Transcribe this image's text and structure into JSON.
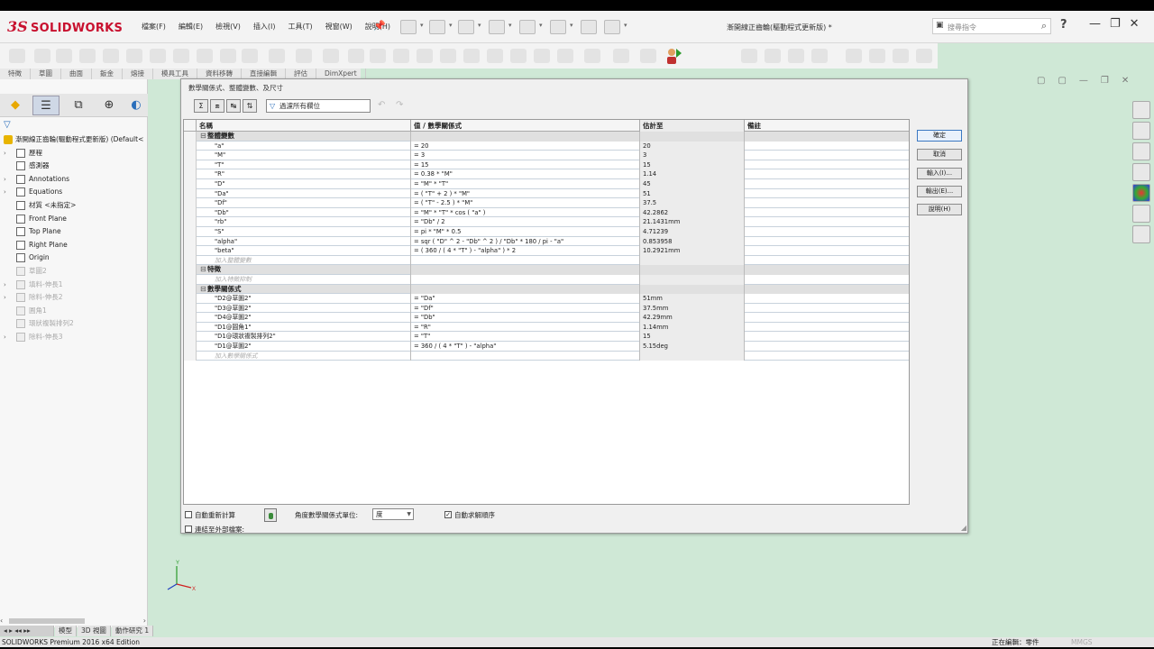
{
  "app": {
    "logo_mark": "3S",
    "logo_text": "SOLIDWORKS",
    "menu": [
      "檔案(F)",
      "編輯(E)",
      "檢視(V)",
      "插入(I)",
      "工具(T)",
      "視窗(W)",
      "說明(H)"
    ],
    "document_title": "漸開線正齒輪(驅動程式更新版) *",
    "search_placeholder": "搜尋指令",
    "help_symbol": "?",
    "window_buttons": [
      "—",
      "❐",
      "✕"
    ],
    "accent_color": "#c8102e"
  },
  "command_tabs": [
    "特徵",
    "草圖",
    "曲面",
    "鈑金",
    "熔接",
    "模具工具",
    "資料移轉",
    "直接編輯",
    "評估",
    "DimXpert"
  ],
  "feature_tree": {
    "root": "漸開線正齒輪(驅動程式更新版)  (Default<",
    "items": [
      {
        "label": "歷程",
        "expand": "›",
        "icon": "history-icon",
        "gray": false
      },
      {
        "label": "感測器",
        "expand": "",
        "icon": "sensor-icon",
        "gray": false
      },
      {
        "label": "Annotations",
        "expand": "›",
        "icon": "annotations-icon",
        "gray": false
      },
      {
        "label": "Equations",
        "expand": "›",
        "icon": "equations-icon",
        "gray": false
      },
      {
        "label": "材質 <未指定>",
        "expand": "",
        "icon": "material-icon",
        "gray": false
      },
      {
        "label": "Front Plane",
        "expand": "",
        "icon": "plane-icon",
        "gray": false
      },
      {
        "label": "Top Plane",
        "expand": "",
        "icon": "plane-icon",
        "gray": false
      },
      {
        "label": "Right Plane",
        "expand": "",
        "icon": "plane-icon",
        "gray": false
      },
      {
        "label": "Origin",
        "expand": "",
        "icon": "origin-icon",
        "gray": false
      },
      {
        "label": "草圖2",
        "expand": "",
        "icon": "sketch-icon",
        "gray": true
      },
      {
        "label": "填料-伸長1",
        "expand": "›",
        "icon": "extrude-icon",
        "gray": true
      },
      {
        "label": "除料-伸長2",
        "expand": "›",
        "icon": "cut-icon",
        "gray": true
      },
      {
        "label": "圓角1",
        "expand": "",
        "icon": "fillet-icon",
        "gray": true
      },
      {
        "label": "環狀複製排列2",
        "expand": "",
        "icon": "pattern-icon",
        "gray": true
      },
      {
        "label": "除料-伸長3",
        "expand": "›",
        "icon": "cut-icon",
        "gray": true
      }
    ]
  },
  "bottom_tabs": [
    "模型",
    "3D 視圖",
    "動作研究 1"
  ],
  "status": {
    "left": "SOLIDWORKS Premium 2016 x64 Edition",
    "editing": "正在編輯：零件",
    "units": "MMGS"
  },
  "dialog": {
    "title": "數學關係式、整體變數、及尺寸",
    "filter_text": "過濾所有欄位",
    "columns": [
      "名稱",
      "值 / 數學關係式",
      "估計至",
      "備註"
    ],
    "sections": [
      {
        "title": "整體變數",
        "rows": [
          {
            "name": "\"a\"",
            "value": "= 20",
            "est": "20"
          },
          {
            "name": "\"M\"",
            "value": "= 3",
            "est": "3"
          },
          {
            "name": "\"T\"",
            "value": "= 15",
            "est": "15"
          },
          {
            "name": "\"R\"",
            "value": "= 0.38 * \"M\"",
            "est": "1.14"
          },
          {
            "name": "\"D\"",
            "value": "= \"M\" * \"T\"",
            "est": "45"
          },
          {
            "name": "\"Da\"",
            "value": "= ( \"T\" + 2 ) * \"M\"",
            "est": "51"
          },
          {
            "name": "\"Df\"",
            "value": "= ( \"T\" - 2.5 ) * \"M\"",
            "est": "37.5"
          },
          {
            "name": "\"Db\"",
            "value": "= \"M\" * \"T\" * cos ( \"a\" )",
            "est": "42.2862"
          },
          {
            "name": "\"rb\"",
            "value": "= \"Db\" / 2",
            "est": "21.1431mm"
          },
          {
            "name": "\"S\"",
            "value": "= pi * \"M\" * 0.5",
            "est": "4.71239"
          },
          {
            "name": "\"alpha\"",
            "value": "= sqr ( \"D\" ^ 2 - \"Db\" ^ 2 ) / \"Db\" * 180 / pi - \"a\"",
            "est": "0.853958"
          },
          {
            "name": "\"beta\"",
            "value": "= ( 360 / ( 4 * \"T\" ) - \"alpha\" ) * 2",
            "est": "10.2921mm"
          }
        ],
        "add_label": "加入整體變數"
      },
      {
        "title": "特徵",
        "rows": [],
        "add_label": "加入特徵抑制"
      },
      {
        "title": "數學關係式",
        "rows": [
          {
            "name": "\"D2@草圖2\"",
            "value": "= \"Da\"",
            "est": "51mm"
          },
          {
            "name": "\"D3@草圖2\"",
            "value": "= \"Df\"",
            "est": "37.5mm"
          },
          {
            "name": "\"D4@草圖2\"",
            "value": "= \"Db\"",
            "est": "42.29mm"
          },
          {
            "name": "\"D1@圓角1\"",
            "value": "= \"R\"",
            "est": "1.14mm"
          },
          {
            "name": "\"D1@環狀複製排列2\"",
            "value": "= \"T\"",
            "est": "15"
          },
          {
            "name": "\"D1@草圖2\"",
            "value": "= 360 / ( 4 * \"T\" ) - \"alpha\"",
            "est": "5.15deg"
          }
        ],
        "add_label": "加入數學關係式"
      }
    ],
    "buttons": {
      "ok": "確定",
      "cancel": "取消",
      "import": "輸入(I)...",
      "export": "輸出(E)...",
      "help": "說明(H)"
    },
    "bottom": {
      "auto_rebuild": "自動重新計算",
      "link_external": "連結至外部檔案:",
      "angle_units_label": "角度數學關係式單位:",
      "angle_units_value": "度",
      "auto_solve": "自動求解順序",
      "auto_solve_checked": true
    }
  }
}
